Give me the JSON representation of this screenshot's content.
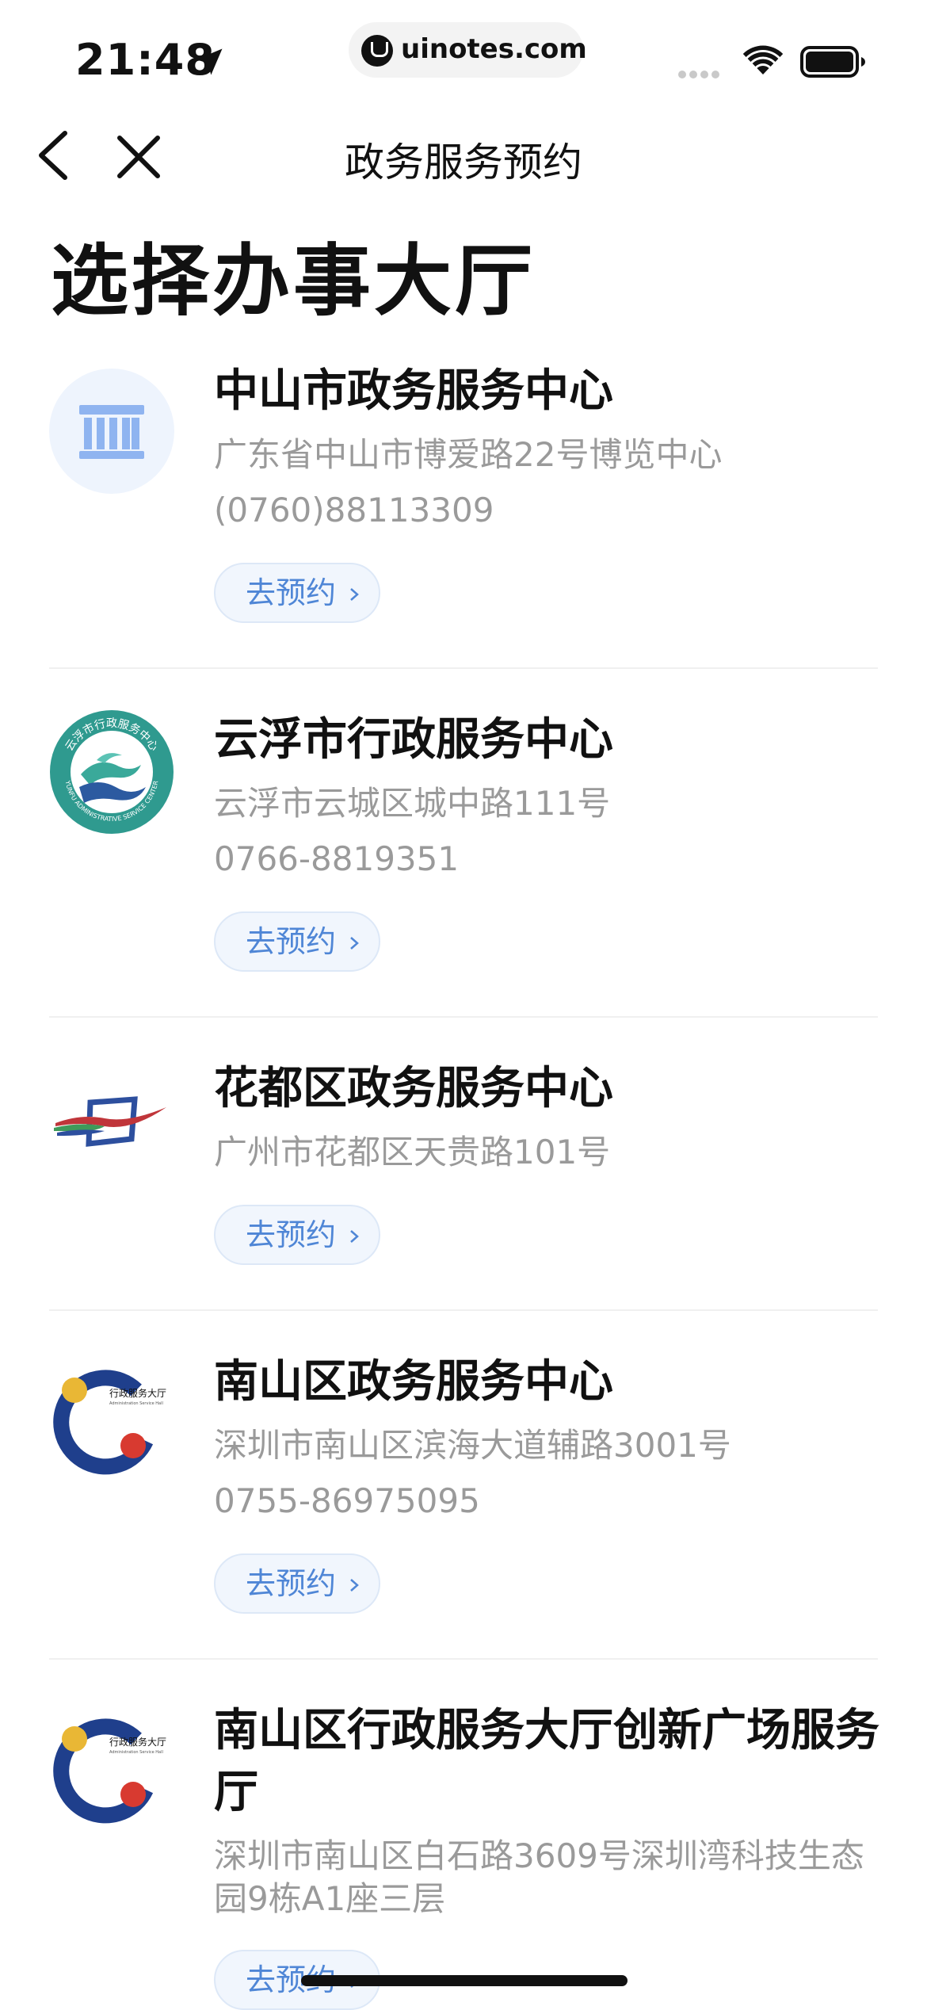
{
  "status_bar": {
    "time": "21:48",
    "url": "uinotes.com"
  },
  "nav": {
    "title": "政务服务预约"
  },
  "page_title": "选择办事大厅",
  "halls": [
    {
      "name": "中山市政务服务中心",
      "address": "广东省中山市博爱路22号博览中心",
      "phone": "(0760)88113309",
      "button": "去预约",
      "logo": "building-icon"
    },
    {
      "name": "云浮市行政服务中心",
      "address": "云浮市云城区城中路111号",
      "phone": "0766-8819351",
      "button": "去预约",
      "logo": "yunfu-admin-service-logo"
    },
    {
      "name": "花都区政务服务中心",
      "address": "广州市花都区天贵路101号",
      "phone": "",
      "button": "去预约",
      "logo": "huadu-logo"
    },
    {
      "name": "南山区政务服务中心",
      "address": "深圳市南山区滨海大道辅路3001号",
      "phone": "0755-86975095",
      "button": "去预约",
      "logo": "nanshan-admin-hall-logo"
    },
    {
      "name": "南山区行政服务大厅创新广场服务厅",
      "address": "深圳市南山区白石路3609号深圳湾科技生态园9栋A1座三层",
      "phone": "",
      "button": "去预约",
      "logo": "nanshan-admin-hall-logo"
    }
  ],
  "logo_text": {
    "yunfu_cn": "云浮市行政服务中心",
    "yunfu_en": "YUNFU ADMINISTRATIVE SERVICE CENTER",
    "nanshan_cn": "行政服务大厅",
    "nanshan_en": "Administration Service Hall"
  },
  "colors": {
    "accent": "#4f86d6",
    "button_bg": "#f1f6fd",
    "muted_text": "#9a9a9a"
  }
}
